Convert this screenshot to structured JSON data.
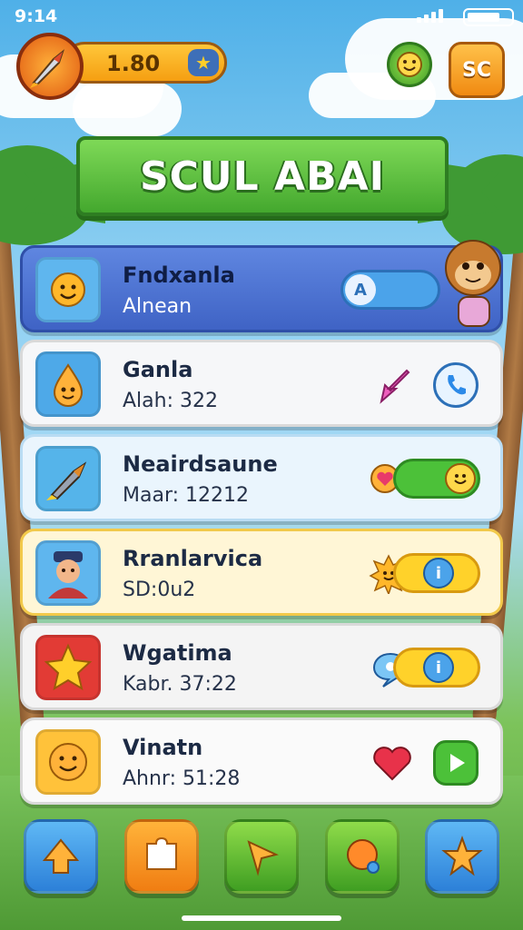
{
  "status_bar": {
    "time": "9:14"
  },
  "hud": {
    "coins": "1.80",
    "menu_button": "SC"
  },
  "banner": {
    "title": "SCUL ABAI"
  },
  "rows": [
    {
      "name": "Fndxanla",
      "sub": "Alnean",
      "control": "toggle"
    },
    {
      "name": "Ganla",
      "sub": "Alah: 322",
      "control": "call"
    },
    {
      "name": "Neairdsaune",
      "sub": "Maar: 12212",
      "control": "toggle"
    },
    {
      "name": "Rranlarvica",
      "sub": "SD:0u2",
      "control": "toggle"
    },
    {
      "name": "Wgatima",
      "sub": "Kabr. 37:22",
      "control": "toggle"
    },
    {
      "name": "Vinatn",
      "sub": "Ahnr: 51:28",
      "control": "play"
    }
  ],
  "colors": {
    "sky": "#4fb0e8",
    "grass": "#5aa83c",
    "banner": "#44a82e",
    "coin": "#ffc63a"
  },
  "icons": {
    "rows": [
      "sun-face-icon",
      "drop-face-icon",
      "rocket-icon",
      "pilot-icon",
      "star-icon",
      "smiley-face-icon"
    ],
    "nav": [
      "up-arrow-icon",
      "puzzle-icon",
      "play-arrow-icon",
      "chat-icon",
      "star-fish-icon"
    ]
  }
}
